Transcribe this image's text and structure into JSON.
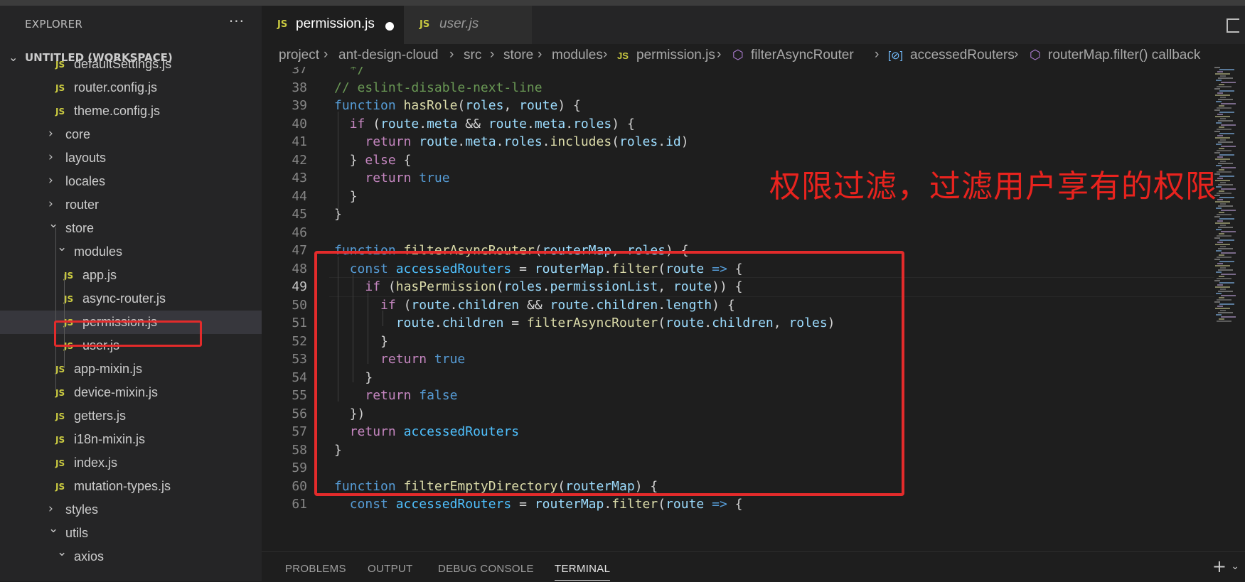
{
  "sidebar": {
    "title": "EXPLORER",
    "more": "···",
    "workspace": "UNTITLED (WORKSPACE)",
    "items": [
      {
        "label": "defaultSettings.js",
        "type": "file"
      },
      {
        "label": "router.config.js",
        "type": "file"
      },
      {
        "label": "theme.config.js",
        "type": "file"
      },
      {
        "label": "core",
        "type": "folder"
      },
      {
        "label": "layouts",
        "type": "folder"
      },
      {
        "label": "locales",
        "type": "folder"
      },
      {
        "label": "router",
        "type": "folder"
      },
      {
        "label": "store",
        "type": "folder-open"
      },
      {
        "label": "modules",
        "type": "folder-open"
      },
      {
        "label": "app.js",
        "type": "file"
      },
      {
        "label": "async-router.js",
        "type": "file"
      },
      {
        "label": "permission.js",
        "type": "file",
        "selected": true
      },
      {
        "label": "user.js",
        "type": "file"
      },
      {
        "label": "app-mixin.js",
        "type": "file"
      },
      {
        "label": "device-mixin.js",
        "type": "file"
      },
      {
        "label": "getters.js",
        "type": "file"
      },
      {
        "label": "i18n-mixin.js",
        "type": "file"
      },
      {
        "label": "index.js",
        "type": "file"
      },
      {
        "label": "mutation-types.js",
        "type": "file"
      },
      {
        "label": "styles",
        "type": "folder"
      },
      {
        "label": "utils",
        "type": "folder-open"
      },
      {
        "label": "axios",
        "type": "folder-open"
      }
    ]
  },
  "tabs": [
    {
      "icon": "JS",
      "label": "permission.js",
      "active": true,
      "dirty": true
    },
    {
      "icon": "JS",
      "label": "user.js",
      "active": false
    }
  ],
  "breadcrumb": {
    "parts": [
      "project",
      "ant-design-cloud",
      "src",
      "store",
      "modules"
    ],
    "file_icon": "JS",
    "file": "permission.js",
    "fn": "filterAsyncRouter",
    "var": "accessedRouters",
    "callback": "routerMap.filter() callback"
  },
  "editor": {
    "current_line": "49",
    "lines": [
      {
        "n": "37",
        "text": "  */"
      },
      {
        "n": "38",
        "text": "// eslint-disable-next-line"
      },
      {
        "n": "39",
        "text": "function hasRole(roles, route) {"
      },
      {
        "n": "40",
        "text": "  if (route.meta && route.meta.roles) {"
      },
      {
        "n": "41",
        "text": "    return route.meta.roles.includes(roles.id)"
      },
      {
        "n": "42",
        "text": "  } else {"
      },
      {
        "n": "43",
        "text": "    return true"
      },
      {
        "n": "44",
        "text": "  }"
      },
      {
        "n": "45",
        "text": "}"
      },
      {
        "n": "46",
        "text": ""
      },
      {
        "n": "47",
        "text": "function filterAsyncRouter(routerMap, roles) {"
      },
      {
        "n": "48",
        "text": "  const accessedRouters = routerMap.filter(route => {"
      },
      {
        "n": "49",
        "text": "    if (hasPermission(roles.permissionList, route)) {"
      },
      {
        "n": "50",
        "text": "      if (route.children && route.children.length) {"
      },
      {
        "n": "51",
        "text": "        route.children = filterAsyncRouter(route.children, roles)"
      },
      {
        "n": "52",
        "text": "      }"
      },
      {
        "n": "53",
        "text": "      return true"
      },
      {
        "n": "54",
        "text": "    }"
      },
      {
        "n": "55",
        "text": "    return false"
      },
      {
        "n": "56",
        "text": "  })"
      },
      {
        "n": "57",
        "text": "  return accessedRouters"
      },
      {
        "n": "58",
        "text": "}"
      },
      {
        "n": "59",
        "text": ""
      },
      {
        "n": "60",
        "text": "function filterEmptyDirectory(routerMap) {"
      },
      {
        "n": "61",
        "text": "  const accessedRouters = routerMap.filter(route => {"
      }
    ]
  },
  "annotation": "权限过滤，过滤用户享有的权限",
  "panel": {
    "tabs": [
      "PROBLEMS",
      "OUTPUT",
      "DEBUG CONSOLE",
      "TERMINAL"
    ],
    "active": "TERMINAL",
    "plus": "+",
    "chevron": "⌄"
  },
  "colors": {
    "annotation_red": "#e32b2b",
    "js_icon": "#cbcb41",
    "keyword": "#c586c0",
    "storage": "#569cd6",
    "function": "#dcdcaa",
    "variable": "#9cdcfe",
    "constant": "#4fc1ff",
    "comment": "#6a9955"
  }
}
